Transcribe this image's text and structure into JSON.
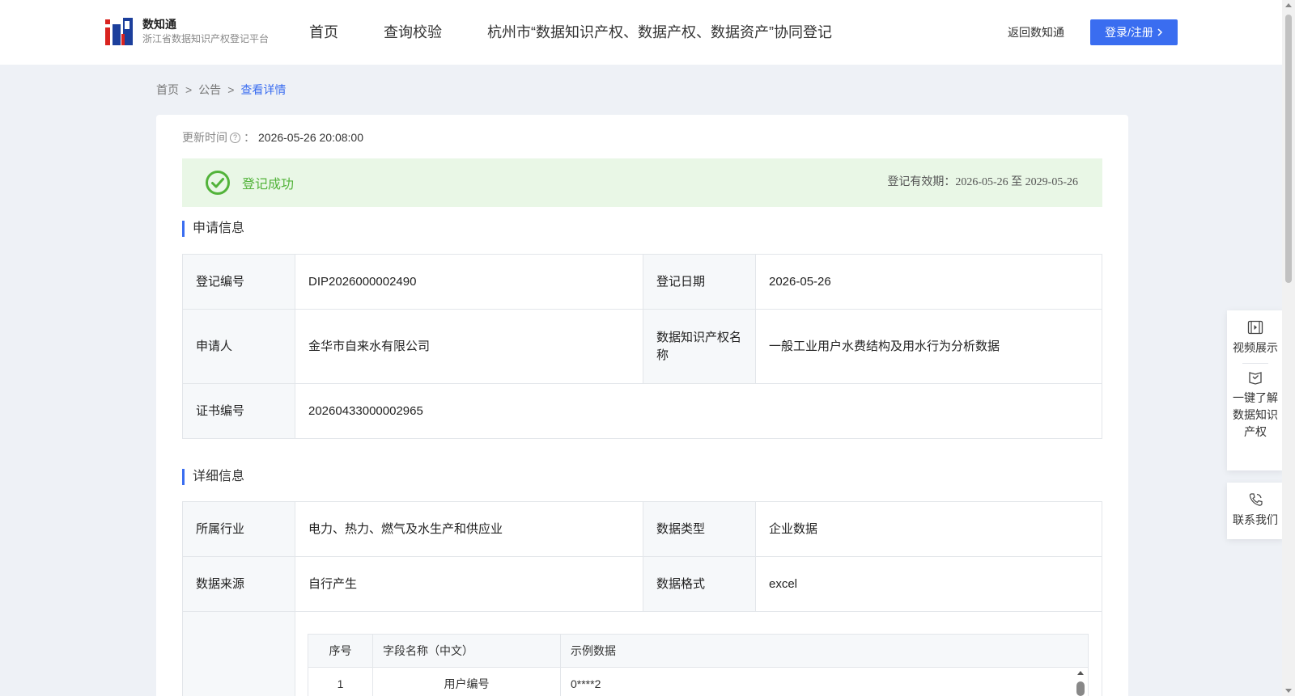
{
  "header": {
    "logo_title": "数知通",
    "logo_subtitle": "浙江省数据知识产权登记平台",
    "nav": [
      "首页",
      "查询校验",
      "杭州市“数据知识产权、数据产权、数据资产”协同登记"
    ],
    "back_link": "返回数知通",
    "login_label": "登录/注册"
  },
  "breadcrumb": [
    "首页",
    "公告",
    "查看详情"
  ],
  "update": {
    "label": "更新时间",
    "colon": "：",
    "value": "2026-05-26 20:08:00"
  },
  "status": {
    "title": "登记成功",
    "validity": "登记有效期：2026-05-26 至 2029-05-26",
    "color": "#52b33a"
  },
  "application": {
    "title": "申请信息",
    "reg_no_label": "登记编号",
    "reg_no": "DIP2026000002490",
    "reg_date_label": "登记日期",
    "reg_date": "2026-05-26",
    "applicant_label": "申请人",
    "applicant": "金华市自来水有限公司",
    "ip_name_label": "数据知识产权名称",
    "ip_name": "一般工业用户水费结构及用水行为分析数据",
    "cert_no_label": "证书编号",
    "cert_no": "20260433000002965"
  },
  "details": {
    "title": "详细信息",
    "industry_label": "所属行业",
    "industry": "电力、热力、燃气及水生产和供应业",
    "data_type_label": "数据类型",
    "data_type": "企业数据",
    "source_label": "数据来源",
    "source": "自行产生",
    "format_label": "数据格式",
    "format": "excel",
    "fields_table": {
      "headers": [
        "序号",
        "字段名称（中文）",
        "示例数据"
      ],
      "rows": [
        {
          "no": "1",
          "name": "用户编号",
          "sample": "0****2"
        }
      ]
    }
  },
  "side_panel": {
    "video": "视频展示",
    "learn": "一键了解数据知识产权",
    "contact": "联系我们"
  },
  "colors": {
    "accent": "#3a6df0",
    "success_bg": "#e9f7e6"
  }
}
